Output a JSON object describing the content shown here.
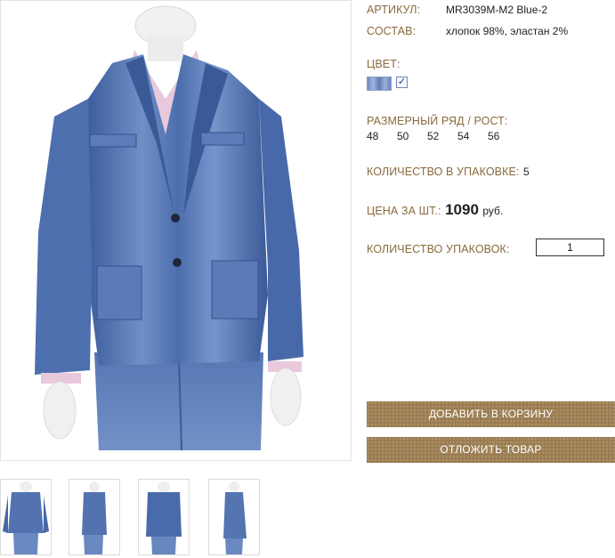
{
  "product": {
    "article_label": "АРТИКУЛ:",
    "article_value": "MR3039M-M2 Blue-2",
    "composition_label": "СОСТАВ:",
    "composition_value": "хлопок 98%, эластан 2%",
    "color_label": "ЦВЕТ:",
    "color_swatch": "#7189c1",
    "color_checked": "✓",
    "size_label": "РАЗМЕРНЫЙ РЯД / РОСТ:",
    "sizes": [
      "48",
      "50",
      "52",
      "54",
      "56"
    ],
    "pack_qty_label": "КОЛИЧЕСТВО В УПАКОВКЕ:",
    "pack_qty_value": "5",
    "price_label": "ЦЕНА ЗА ШТ.:",
    "price_value": "1090",
    "price_currency": "руб.",
    "packs_label": "КОЛИЧЕСТВО УПАКОВОК:",
    "packs_value": "1"
  },
  "actions": {
    "add_to_cart": "ДОБАВИТЬ В КОРЗИНУ",
    "postpone": "ОТЛОЖИТЬ ТОВАР"
  },
  "colors": {
    "label": "#8a6a3e",
    "button": "#9b7d51",
    "denim": "#4a6cab"
  },
  "gallery": {
    "main_image": "denim-blazer-front-photo",
    "thumbnails": [
      "denim-blazer-front-thumb",
      "denim-blazer-side-thumb",
      "denim-blazer-back-thumb",
      "denim-blazer-profile-thumb"
    ]
  }
}
